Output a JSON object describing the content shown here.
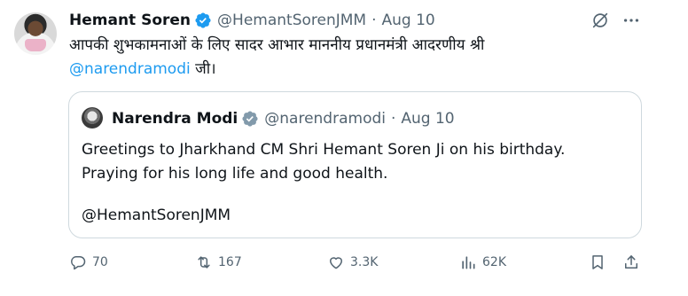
{
  "tweet": {
    "author_name": "Hemant Soren",
    "author_handle": "@HemantSorenJMM",
    "separator": "·",
    "date": "Aug 10",
    "text_before": "आपकी शुभकामनाओं के लिए सादर आभार माननीय प्रधानमंत्री आदरणीय श्री",
    "mention": "@narendramodi",
    "text_after": " जी।",
    "verified_color": "#1d9bf0"
  },
  "quote": {
    "author_name": "Narendra Modi",
    "author_handle": "@narendramodi",
    "separator": "·",
    "date": "Aug 10",
    "line1": "Greetings to Jharkhand CM Shri Hemant Soren Ji on his birthday.",
    "line2": "Praying for his long life and good health.",
    "tagged": "@HemantSorenJMM",
    "verified_color": "#829aab"
  },
  "actions": {
    "replies": "70",
    "retweets": "167",
    "likes": "3.3K",
    "views": "62K"
  },
  "icons": [
    "grok-icon",
    "more-icon",
    "reply-icon",
    "retweet-icon",
    "like-icon",
    "views-icon",
    "bookmark-icon",
    "share-icon"
  ],
  "colors": {
    "text": "#0f1419",
    "muted": "#536471",
    "link": "#1d9bf0",
    "border": "#cfd9de"
  }
}
